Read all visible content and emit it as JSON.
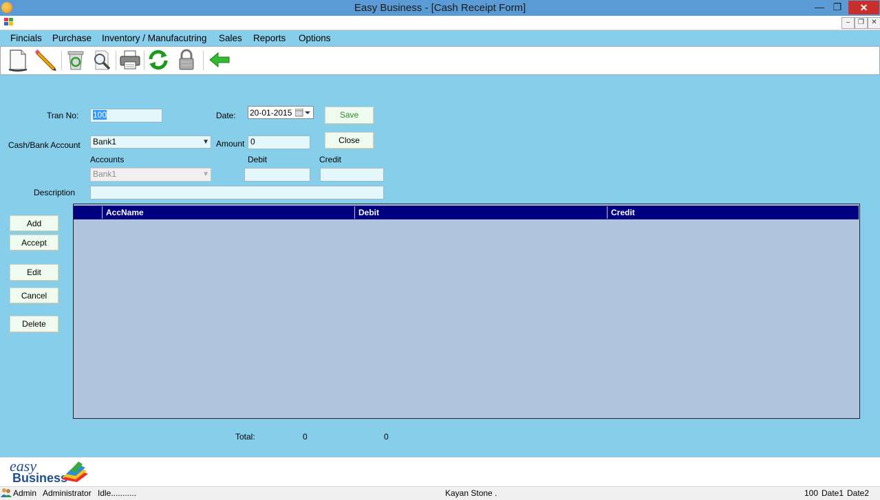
{
  "window": {
    "title": "Easy Business - [Cash Receipt Form]",
    "minimize": "—",
    "restore": "❐",
    "close": "✕"
  },
  "mdi": {
    "minimize": "–",
    "restore": "❐",
    "close": "✕"
  },
  "menu": [
    "Fincials",
    "Purchase",
    "Inventory / Manufacutring",
    "Sales",
    "Reports",
    "Options"
  ],
  "toolbar": [
    "new-document-icon",
    "edit-pencil-icon",
    "recycle-bin-icon",
    "magnifier-search-icon",
    "printer-icon",
    "refresh-icon",
    "padlock-icon",
    "back-arrow-icon"
  ],
  "form": {
    "tran_no_label": "Tran No:",
    "tran_no_value": "100",
    "date_label": "Date:",
    "date_value": "20-01-2015",
    "save_label": "Save",
    "close_label": "Close",
    "cash_bank_label": "Cash/Bank Account",
    "cash_bank_value": "Bank1",
    "amount_label": "Amount",
    "amount_value": "0",
    "accounts_label": "Accounts",
    "accounts_value": "Bank1",
    "debit_label": "Debit",
    "credit_label": "Credit",
    "debit_value": "",
    "credit_value": "",
    "description_label": "Description",
    "description_value": ""
  },
  "side_buttons": {
    "add": "Add",
    "accept": "Accept",
    "edit": "Edit",
    "cancel": "Cancel",
    "delete": "Delete"
  },
  "grid": {
    "columns": [
      "AccName",
      "Debit",
      "Credit"
    ],
    "rows": []
  },
  "totals": {
    "label": "Total:",
    "debit": "0",
    "credit": "0"
  },
  "logo": {
    "line1": "easy",
    "line2": "Business"
  },
  "status": {
    "user": "Admin",
    "role": "Administrator",
    "state": "Idle...........",
    "company": "Kayan Stone .",
    "tran": "100",
    "date1": "Date1",
    "date2": "Date2"
  },
  "colors": {
    "background": "#87ceeb",
    "grid_header": "#000080",
    "grid_body": "#b0c4de",
    "save_text": "#2e8b2e"
  }
}
